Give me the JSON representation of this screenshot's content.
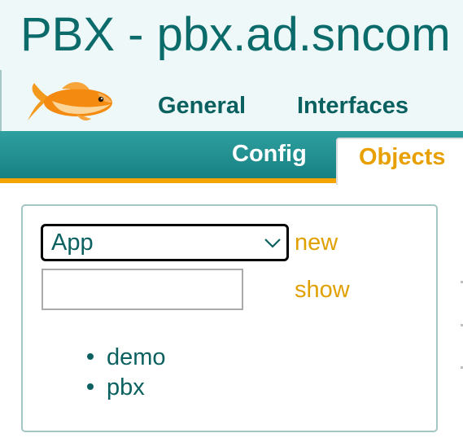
{
  "header": {
    "title": "PBX - pbx.ad.sncom"
  },
  "nav": {
    "items": [
      {
        "label": "General"
      },
      {
        "label": "Interfaces"
      }
    ]
  },
  "tabs": [
    {
      "label": "Config",
      "active": false
    },
    {
      "label": "Objects",
      "active": true
    }
  ],
  "panel": {
    "type_select": {
      "value": "App"
    },
    "new_label": "new",
    "name_input": {
      "value": "",
      "placeholder": ""
    },
    "show_label": "show",
    "objects": [
      "demo",
      "pbx"
    ]
  },
  "colors": {
    "primary_teal": "#0b6b6b",
    "tabbar": "#1e8c8d",
    "accent_orange": "#f4a400",
    "link": "#e0a000"
  },
  "icons": {
    "logo": "goldfish-icon",
    "select_arrow": "chevron-down-icon"
  }
}
